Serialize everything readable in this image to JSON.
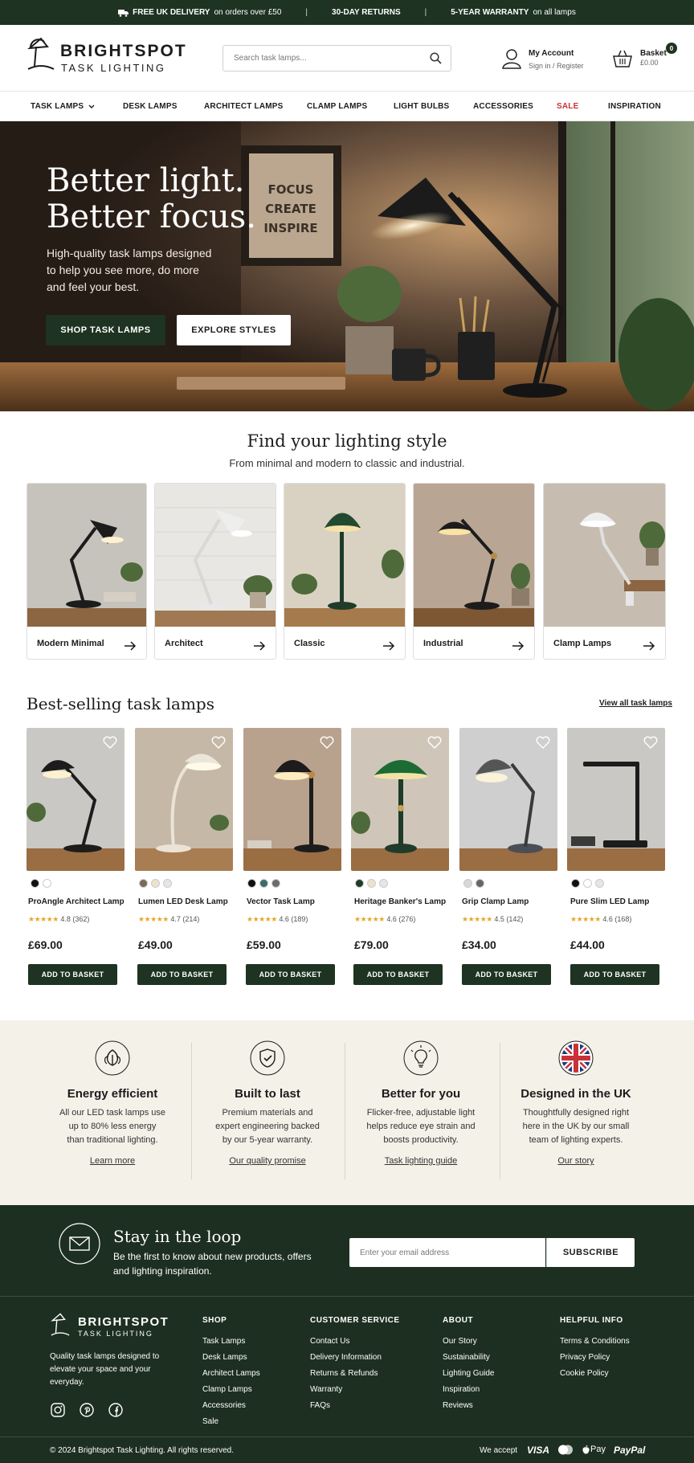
{
  "topbar": {
    "delivery_bold": "FREE UK DELIVERY",
    "delivery_rest": "on orders over £50",
    "returns": "30-DAY RETURNS",
    "warranty_bold": "5-YEAR WARRANTY",
    "warranty_rest": "on all lamps"
  },
  "header": {
    "brand": "BRIGHTSPOT",
    "brand_sub": "TASK LIGHTING",
    "search_placeholder": "Search task lamps...",
    "account_title": "My Account",
    "account_sub": "Sign in / Register",
    "basket_title": "Basket",
    "basket_total": "£0.00",
    "basket_count": "0"
  },
  "nav": {
    "items": [
      "TASK LAMPS",
      "DESK LAMPS",
      "ARCHITECT LAMPS",
      "CLAMP LAMPS",
      "LIGHT BULBS",
      "ACCESSORIES",
      "SALE",
      "INSPIRATION"
    ]
  },
  "hero": {
    "title_line1": "Better light.",
    "title_line2": "Better focus.",
    "desc_line1": "High-quality task lamps designed",
    "desc_line2": "to help you see more, do more",
    "desc_line3": "and feel your best.",
    "cta_primary": "SHOP TASK LAMPS",
    "cta_secondary": "EXPLORE STYLES",
    "frame_text": [
      "FOCUS",
      "CREATE",
      "INSPIRE"
    ]
  },
  "styles": {
    "title": "Find your lighting style",
    "subtitle": "From minimal and modern to classic and industrial.",
    "cards": [
      {
        "label": "Modern Minimal"
      },
      {
        "label": "Architect"
      },
      {
        "label": "Classic"
      },
      {
        "label": "Industrial"
      },
      {
        "label": "Clamp Lamps"
      }
    ]
  },
  "bestsellers": {
    "title": "Best-selling task lamps",
    "view_all": "View all task lamps",
    "add_label": "ADD TO BASKET",
    "products": [
      {
        "name": "ProAngle Architect Lamp",
        "rating": "4.8",
        "reviews": "(362)",
        "price": "£69.00",
        "stars": 4.8
      },
      {
        "name": "Lumen LED Desk Lamp",
        "rating": "4.7",
        "reviews": "(214)",
        "price": "£49.00",
        "stars": 4.7
      },
      {
        "name": "Vector Task Lamp",
        "rating": "4.6",
        "reviews": "(189)",
        "price": "£59.00",
        "stars": 4.6
      },
      {
        "name": "Heritage Banker's Lamp",
        "rating": "4.6",
        "reviews": "(276)",
        "price": "£79.00",
        "stars": 4.6
      },
      {
        "name": "Grip Clamp Lamp",
        "rating": "4.5",
        "reviews": "(142)",
        "price": "£34.00",
        "stars": 4.5
      },
      {
        "name": "Pure Slim LED Lamp",
        "rating": "4.6",
        "reviews": "(168)",
        "price": "£44.00",
        "stars": 4.6
      }
    ]
  },
  "features": [
    {
      "title": "Energy efficient",
      "desc": [
        "All our LED task lamps use",
        "up to 80% less energy",
        "than traditional lighting."
      ],
      "link": "Learn more",
      "icon": "leaf-icon"
    },
    {
      "title": "Built to last",
      "desc": [
        "Premium materials and",
        "expert engineering backed",
        "by our 5-year warranty."
      ],
      "link": "Our quality promise",
      "icon": "shield-check-icon"
    },
    {
      "title": "Better for you",
      "desc": [
        "Flicker-free, adjustable light",
        "helps reduce eye strain and",
        "boosts productivity."
      ],
      "link": "Task lighting guide",
      "icon": "lightbulb-icon"
    },
    {
      "title": "Designed in the UK",
      "desc": [
        "Thoughtfully designed right",
        "here in the UK by our small",
        "team of lighting experts."
      ],
      "link": "Our story",
      "icon": "union-flag-icon"
    }
  ],
  "newsletter": {
    "title": "Stay in the loop",
    "desc_line1": "Be the first to know about new products, offers",
    "desc_line2": "and lighting inspiration.",
    "placeholder": "Enter your email address",
    "button": "SUBSCRIBE"
  },
  "footer": {
    "tagline": [
      "Quality task lamps designed to",
      "elevate your space and your",
      "everyday."
    ],
    "columns": [
      {
        "heading": "SHOP",
        "items": [
          "Task Lamps",
          "Desk Lamps",
          "Architect Lamps",
          "Clamp Lamps",
          "Accessories",
          "Sale"
        ]
      },
      {
        "heading": "CUSTOMER SERVICE",
        "items": [
          "Contact Us",
          "Delivery Information",
          "Returns & Refunds",
          "Warranty",
          "FAQs"
        ]
      },
      {
        "heading": "ABOUT",
        "items": [
          "Our Story",
          "Sustainability",
          "Lighting Guide",
          "Inspiration",
          "Reviews"
        ]
      },
      {
        "heading": "HELPFUL INFO",
        "items": [
          "Terms & Conditions",
          "Privacy Policy",
          "Cookie Policy"
        ]
      }
    ],
    "copyright": "© 2024 Brightspot Task Lighting. All rights reserved.",
    "we_accept": "We accept",
    "payments": [
      "VISA",
      "Pay",
      "PayPal"
    ]
  },
  "colors": {
    "brand_green": "#1e3322",
    "sale_red": "#c8323a",
    "star": "#e3a92b",
    "cream": "#f4f1e9"
  }
}
